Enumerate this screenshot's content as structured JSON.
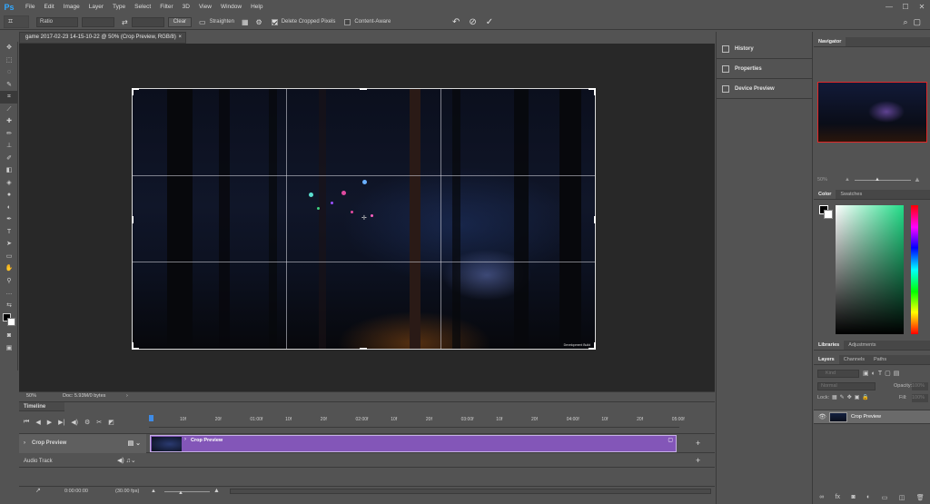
{
  "app": {
    "logo": "Ps"
  },
  "menu": [
    "File",
    "Edit",
    "Image",
    "Layer",
    "Type",
    "Select",
    "Filter",
    "3D",
    "View",
    "Window",
    "Help"
  ],
  "window_controls": {
    "minimize": "—",
    "maximize": "☐",
    "close": "✕"
  },
  "options": {
    "ratio_label": "Ratio",
    "clear_label": "Clear",
    "straighten_label": "Straighten",
    "delete_cropped": "Delete Cropped Pixels",
    "delete_cropped_checked": true,
    "content_aware": "Content-Aware",
    "content_aware_checked": false,
    "reset_icon": "undo-icon",
    "cancel_icon": "cancel-icon",
    "commit_icon": "check-icon"
  },
  "document": {
    "tab_title": "game 2017-02-23 14-15-10-22 @ 50% (Crop Preview, RGB/8)",
    "watermark": "Development Build"
  },
  "status": {
    "zoom": "50%",
    "doc": "Doc: 5.93M/0 bytes"
  },
  "timeline": {
    "title": "Timeline",
    "ticks": [
      "10f",
      "20f",
      "01:00f",
      "10f",
      "20f",
      "02:00f",
      "10f",
      "20f",
      "03:00f",
      "10f",
      "20f",
      "04:00f",
      "10f",
      "20f",
      "05:00f"
    ],
    "track_name": "Crop Preview",
    "clip_label": "Crop Preview",
    "audio_track": "Audio Track",
    "timecode": "0:00:00:00",
    "fps": "(30.00 fps)"
  },
  "midpanel": {
    "items": [
      "History",
      "Properties",
      "Device Preview"
    ]
  },
  "navigator": {
    "tab": "Navigator",
    "zoom": "50%"
  },
  "color": {
    "tabs": [
      "Color",
      "Swatches"
    ]
  },
  "libraries": {
    "tabs": [
      "Libraries",
      "Adjustments"
    ]
  },
  "layers": {
    "tabs": [
      "Layers",
      "Channels",
      "Paths"
    ],
    "kind_placeholder": "Kind",
    "blend_mode": "Normal",
    "opacity_label": "Opacity:",
    "opacity_value": "100%",
    "lock_label": "Lock:",
    "fill_label": "Fill:",
    "fill_value": "100%",
    "layer_name": "Crop Preview"
  }
}
